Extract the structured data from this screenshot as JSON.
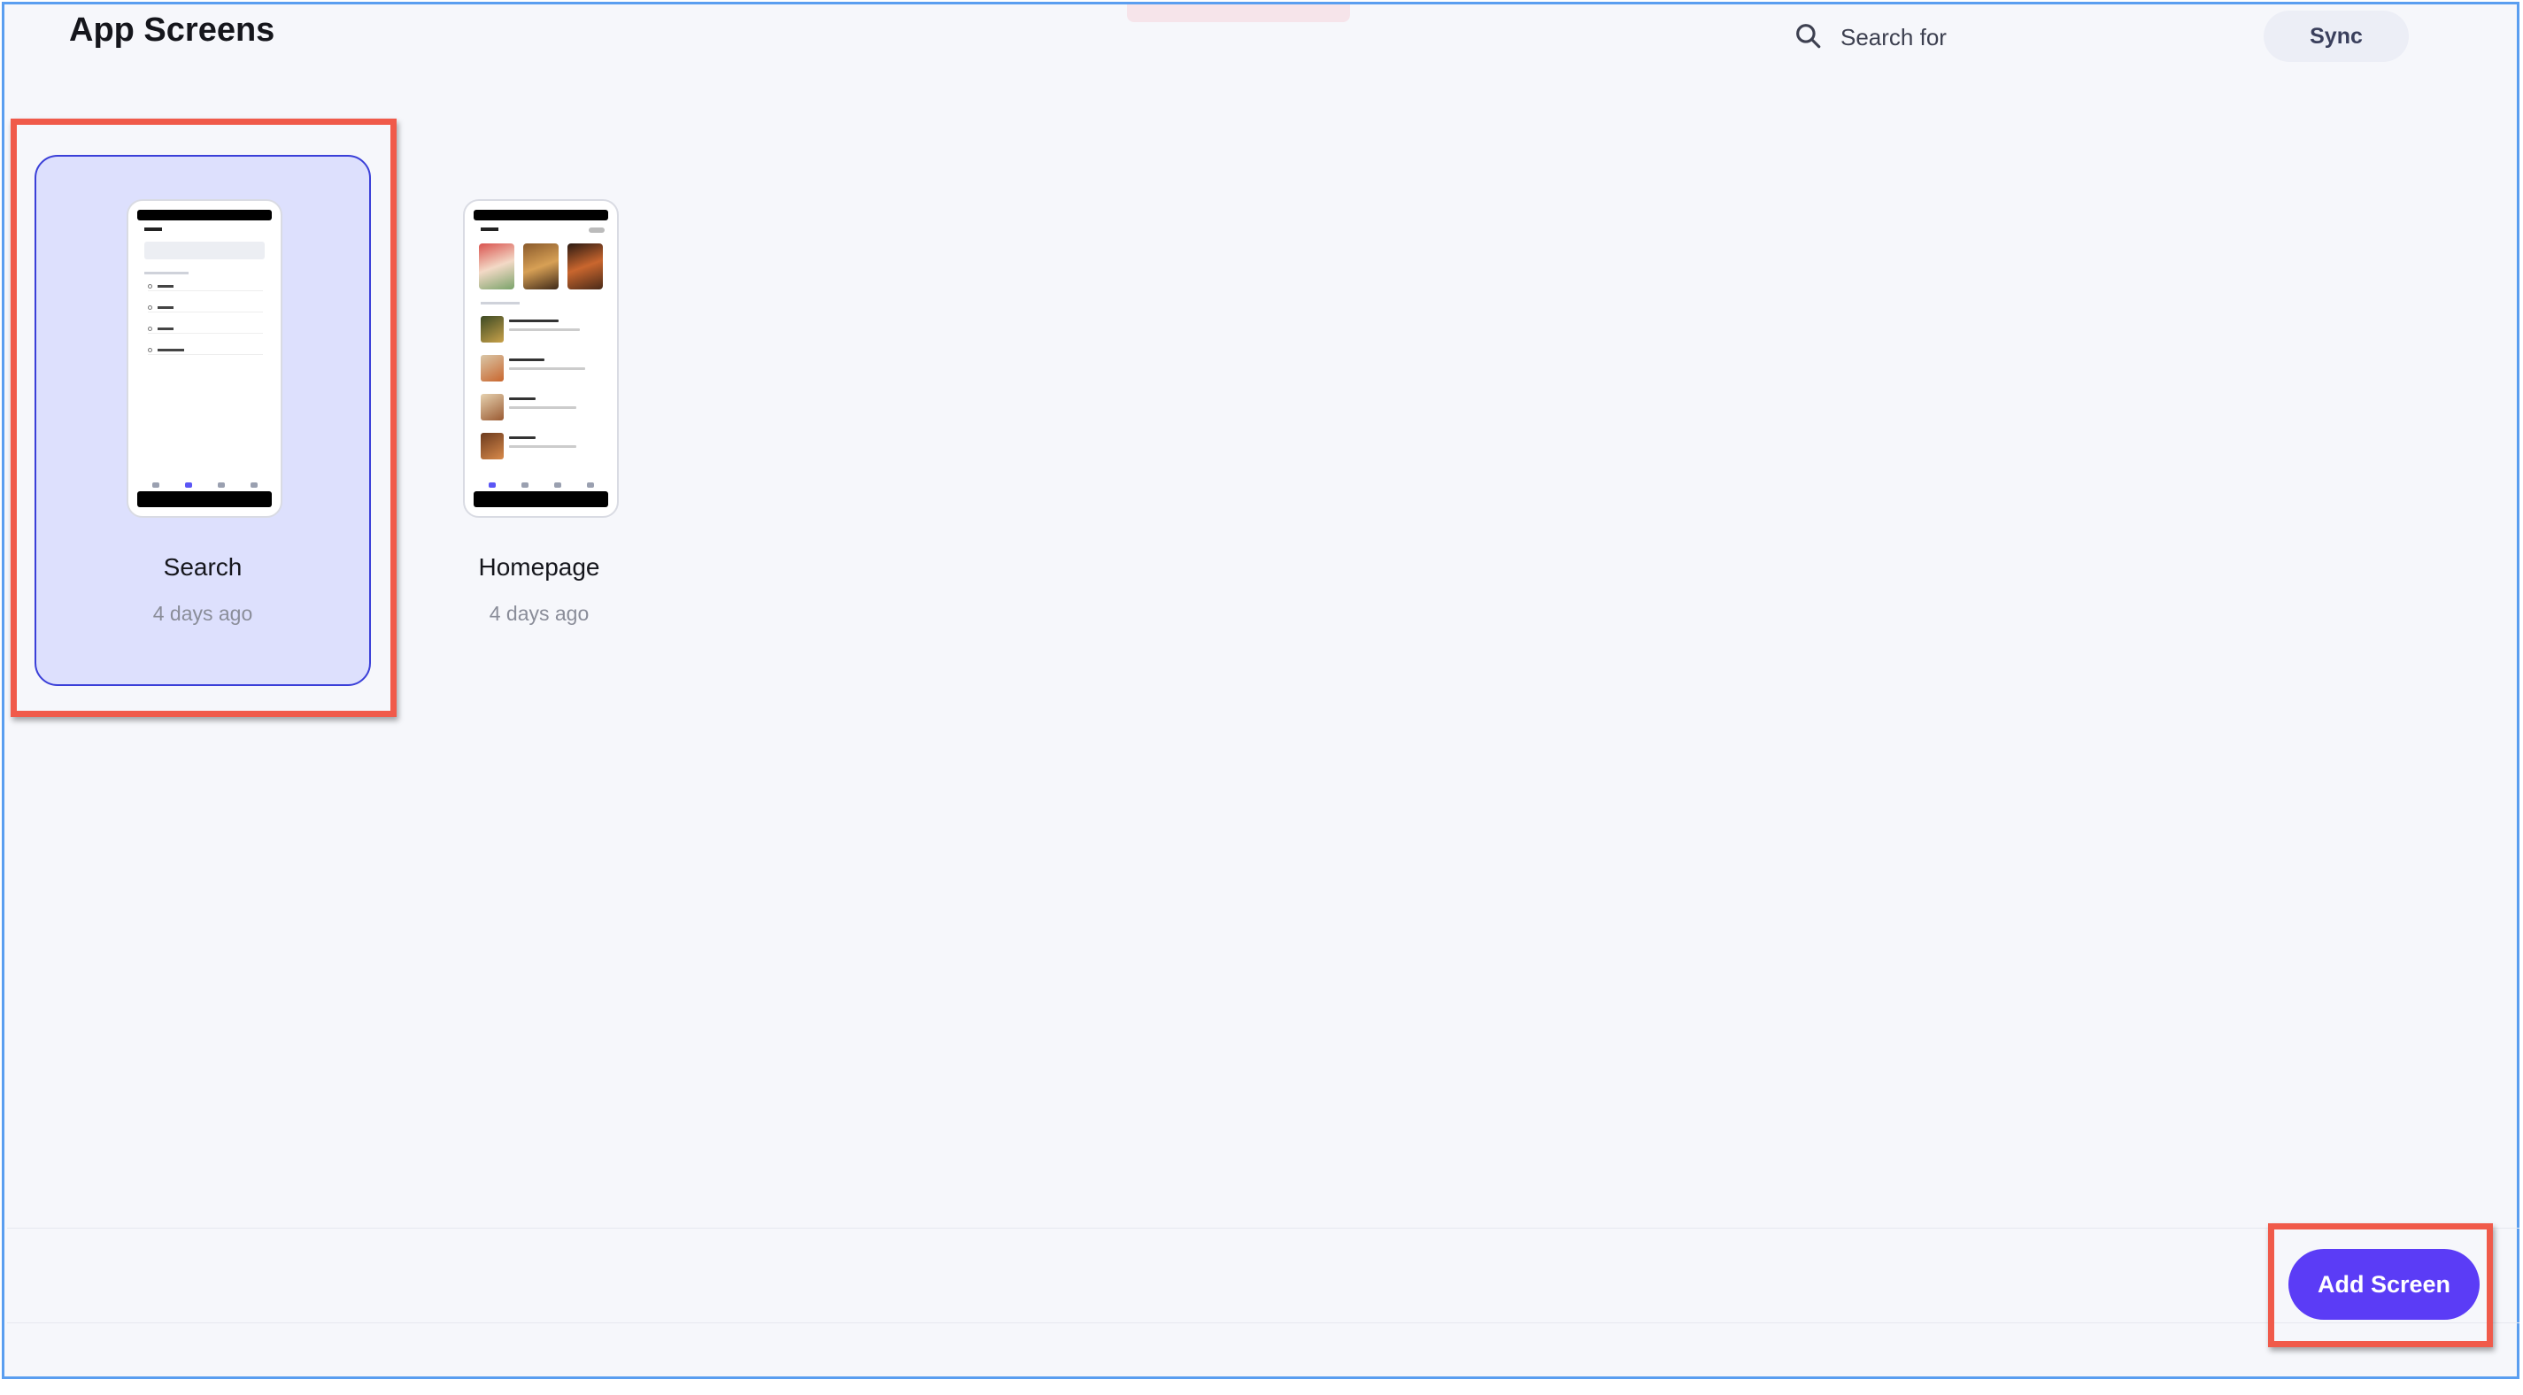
{
  "header": {
    "title": "App Screens",
    "search_placeholder": "Search for",
    "sync_label": "Sync"
  },
  "screens": [
    {
      "label": "Search",
      "time": "4 days ago",
      "selected": true
    },
    {
      "label": "Homepage",
      "time": "4 days ago",
      "selected": false
    }
  ],
  "footer": {
    "add_label": "Add Screen"
  },
  "colors": {
    "accent": "#5b3cf6",
    "selected_bg": "#dde0fd",
    "highlight": "#f05a4a"
  }
}
